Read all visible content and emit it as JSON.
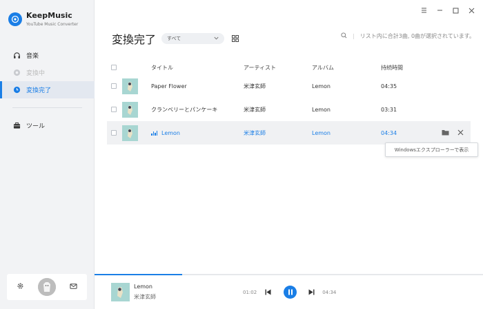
{
  "app": {
    "title": "KeepMusic",
    "subtitle": "YouTube Music Converter"
  },
  "sidebar": {
    "items": [
      {
        "label": "音楽",
        "icon": "headphones-icon",
        "state": "normal"
      },
      {
        "label": "変換中",
        "icon": "converting-icon",
        "state": "disabled"
      },
      {
        "label": "変換完了",
        "icon": "clock-icon",
        "state": "active"
      },
      {
        "label": "ツール",
        "icon": "toolbox-icon",
        "state": "normal"
      }
    ]
  },
  "header": {
    "title": "変換完了",
    "filter_value": "すべて",
    "status_text": "リスト内に合計3曲, 0曲が選択されています。"
  },
  "table": {
    "columns": [
      "タイトル",
      "アーティスト",
      "アルバム",
      "持続時間"
    ],
    "rows": [
      {
        "title": "Paper Flower",
        "artist": "米津玄師",
        "album": "Lemon",
        "duration": "04:35",
        "selected": false
      },
      {
        "title": "クランベリーとパンケーキ",
        "artist": "米津玄師",
        "album": "Lemon",
        "duration": "03:31",
        "selected": false
      },
      {
        "title": "Lemon",
        "artist": "米津玄師",
        "album": "Lemon",
        "duration": "04:34",
        "selected": true
      }
    ]
  },
  "tooltip": {
    "text": "Windowsエクスプローラーで表示"
  },
  "player": {
    "title": "Lemon",
    "artist": "米津玄師",
    "current_time": "01:02",
    "total_time": "04:34",
    "progress": 0.226
  },
  "colors": {
    "accent": "#1a7ee6",
    "sidebar_bg": "#f2f3f5",
    "selected_row": "#f0f1f3",
    "album_art": "#a8d6d2"
  }
}
